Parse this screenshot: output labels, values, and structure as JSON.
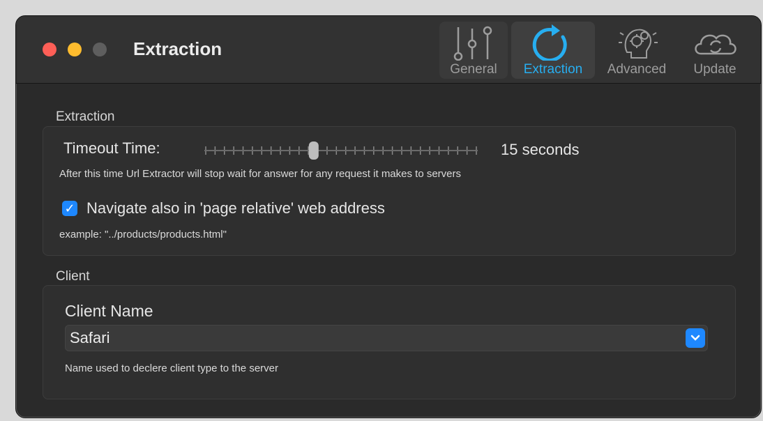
{
  "window": {
    "title": "Extraction"
  },
  "toolbar": {
    "items": [
      {
        "label": "General",
        "icon": "sliders-icon",
        "selected": false
      },
      {
        "label": "Extraction",
        "icon": "refresh-icon",
        "selected": true
      },
      {
        "label": "Advanced",
        "icon": "gears-head-icon",
        "selected": false
      },
      {
        "label": "Update",
        "icon": "cloud-sync-icon",
        "selected": false
      }
    ]
  },
  "extraction": {
    "section_label": "Extraction",
    "timeout_label": "Timeout Time:",
    "timeout_value": "15",
    "timeout_unit": "seconds",
    "timeout_level": 0.4,
    "timeout_help": "After this time Url Extractor will stop wait for answer for any request it makes to servers",
    "relative_checked": true,
    "relative_label": "Navigate also in 'page relative' web address",
    "relative_example": "example: \"../products/products.html\""
  },
  "client": {
    "section_label": "Client",
    "name_label": "Client Name",
    "name_value": "Safari",
    "name_help": "Name used to declere client type to the server"
  },
  "colors": {
    "accent": "#27aef0",
    "checkbox": "#1e88ff",
    "close": "#fe5f57",
    "minimize": "#febc2e"
  }
}
